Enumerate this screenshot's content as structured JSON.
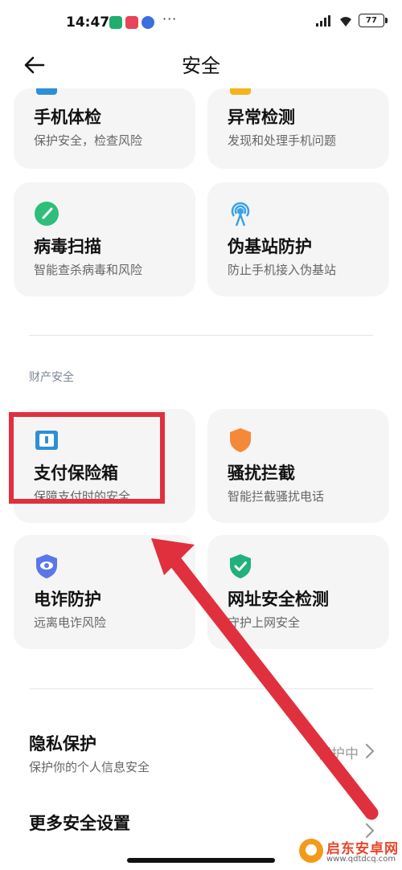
{
  "status_bar": {
    "time": "14:47",
    "dots": "···",
    "battery": "77"
  },
  "header": {
    "title": "安全",
    "back_icon": "arrow-left-icon"
  },
  "cards": {
    "phone_checkup": {
      "title": "手机体检",
      "subtitle": "保护安全，检查风险",
      "icon": "monitor-icon",
      "color": "#2e8fd8"
    },
    "anomaly_detection": {
      "title": "异常检测",
      "subtitle": "发现和处理手机问题",
      "icon": "warning-icon",
      "color": "#f5b21b"
    },
    "virus_scan": {
      "title": "病毒扫描",
      "subtitle": "智能查杀病毒和风险",
      "icon": "scan-gauge-icon",
      "color": "#2fbe7a"
    },
    "fake_station": {
      "title": "伪基站防护",
      "subtitle": "防止手机接入伪基站",
      "icon": "signal-tower-icon",
      "color": "#3aa2e8"
    }
  },
  "sections": {
    "finance_security": {
      "label": "财产安全",
      "cards": {
        "payment_safe": {
          "title": "支付保险箱",
          "subtitle": "保障支付时的安全",
          "icon": "safe-box-icon",
          "color": "#2e8fd8"
        },
        "harassment_block": {
          "title": "骚扰拦截",
          "subtitle": "智能拦截骚扰电话",
          "icon": "shield-icon",
          "color": "#f5893a"
        },
        "fraud_protection": {
          "title": "电诈防护",
          "subtitle": "远离电诈风险",
          "icon": "eye-shield-icon",
          "color": "#5b76e8"
        },
        "url_check": {
          "title": "网址安全检测",
          "subtitle": "守护上网安全",
          "icon": "check-shield-icon",
          "color": "#22b07d"
        }
      }
    }
  },
  "list": {
    "privacy": {
      "title": "隐私保护",
      "subtitle": "保护你的个人信息安全",
      "status": "保护中"
    },
    "more_settings": {
      "title": "更多安全设置"
    }
  },
  "annotation": {
    "highlight_color": "#e0303e"
  },
  "watermark": {
    "name": "启东安卓网",
    "url": "www.qdtdcq.com"
  }
}
